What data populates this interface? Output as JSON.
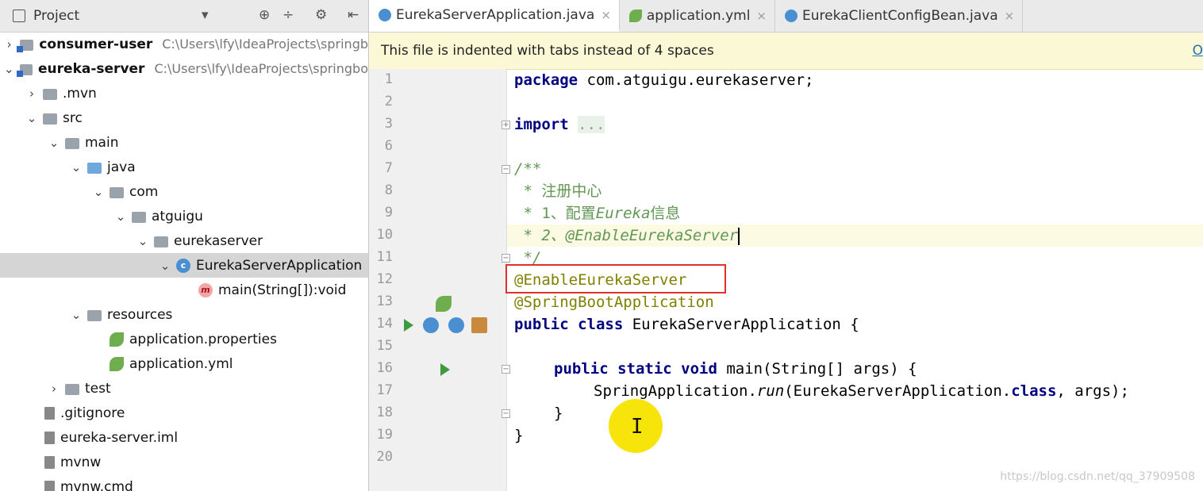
{
  "project_panel": {
    "title": "Project",
    "tree": [
      {
        "label": "consumer-user",
        "path": "C:\\Users\\lfy\\IdeaProjects\\springb",
        "bold": true
      },
      {
        "label": "eureka-server",
        "path": "C:\\Users\\lfy\\IdeaProjects\\springbo",
        "bold": true
      },
      {
        "label": ".mvn"
      },
      {
        "label": "src"
      },
      {
        "label": "main"
      },
      {
        "label": "java"
      },
      {
        "label": "com"
      },
      {
        "label": "atguigu"
      },
      {
        "label": "eurekaserver"
      },
      {
        "label": "EurekaServerApplication",
        "selected": true
      },
      {
        "label": "main(String[]):void"
      },
      {
        "label": "resources"
      },
      {
        "label": "application.properties"
      },
      {
        "label": "application.yml"
      },
      {
        "label": "test"
      },
      {
        "label": ".gitignore"
      },
      {
        "label": "eureka-server.iml"
      },
      {
        "label": "mvnw"
      },
      {
        "label": "mvnw.cmd"
      }
    ]
  },
  "editor": {
    "tabs": [
      {
        "label": "EurekaServerApplication.java",
        "icon": "class-icon",
        "active": true
      },
      {
        "label": "application.yml",
        "icon": "spring-leaf-icon"
      },
      {
        "label": "EurekaClientConfigBean.java",
        "icon": "class-icon"
      }
    ],
    "close_glyph": "×",
    "banner": {
      "message": "This file is indented with tabs instead of 4 spaces",
      "link": "O"
    },
    "line_numbers": [
      "1",
      "2",
      "3",
      "6",
      "7",
      "8",
      "9",
      "10",
      "11",
      "12",
      "13",
      "14",
      "15",
      "16",
      "17",
      "18",
      "19",
      "20"
    ],
    "code": {
      "l1_kw": "package",
      "l1_rest": " com.atguigu.eurekaserver;",
      "l3_kw": "import",
      "l3_fold": "...",
      "l7": "/**",
      "l8": " * 注册中心",
      "l9_a": " * 1、配置",
      "l9_b": "Eureka",
      "l9_c": "信息",
      "l10": " * 2、@EnableEurekaServer",
      "l11": " */",
      "l12": "@EnableEurekaServer",
      "l13": "@SpringBootApplication",
      "l14_kw": "public class",
      "l14_rest": " EurekaServerApplication {",
      "l16_kw": "public static void",
      "l16_rest": " main(String[] args) {",
      "l17_a": "SpringApplication.",
      "l17_b": "run",
      "l17_c": "(EurekaServerApplication.",
      "l17_d": "class",
      "l17_e": ", args);",
      "l18": "}",
      "l19": "}"
    }
  },
  "watermark": "https://blog.csdn.net/qq_37909508",
  "colors": {
    "highlight_box": "#e0302c",
    "cursor_dot": "#f6e40a",
    "banner_bg": "#fbf8d6"
  }
}
